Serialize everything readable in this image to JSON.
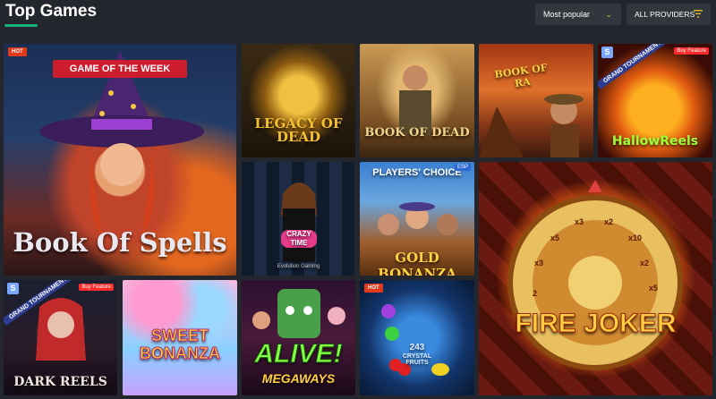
{
  "header": {
    "title": "Top Games",
    "sort": {
      "value": "Most popular"
    },
    "providers": {
      "label": "ALL PROVIDERS"
    }
  },
  "colors": {
    "background": "#23262c",
    "accent": "#18b37a",
    "control_bg": "#32363d",
    "chevron": "#e3b62a",
    "hot_badge": "#e03a1a"
  },
  "icons": {
    "sort_chevron": "chevron-down-icon",
    "providers_filter": "filter-icon"
  },
  "games": [
    {
      "name": "Book Of Spells",
      "hot_badge": "HOT",
      "ribbon": "GAME OF THE WEEK"
    },
    {
      "name": "LEGACY OF DEAD"
    },
    {
      "name": "BOOK OF DEAD"
    },
    {
      "name": "BOOK OF RA"
    },
    {
      "name": "HallowReels",
      "corner_tag": "Buy Feature",
      "badge": "S",
      "tag": "GRAND TOURNAMENT"
    },
    {
      "name": "CRAZY TIME",
      "footer": "Evolution Gaming"
    },
    {
      "name": "GOLD BONANZA",
      "banner": "PLAYERS' CHOICE",
      "corner_tag": "ESP"
    },
    {
      "name": "FIRE JOKER",
      "wheel_labels": [
        "x3",
        "x2",
        "x5",
        "x10",
        "x2",
        "x5",
        "x3",
        "2"
      ]
    },
    {
      "name": "DARK REELS",
      "corner_tag": "Buy Feature",
      "badge": "S",
      "tag": "GRAND TOURNAMENT"
    },
    {
      "name": "SWEET BONANZA"
    },
    {
      "name": "ALIVE!",
      "subtitle": "MEGAWAYS"
    },
    {
      "name": "CRYSTAL FRUITS",
      "count": "243",
      "hot_badge": "HOT"
    }
  ]
}
